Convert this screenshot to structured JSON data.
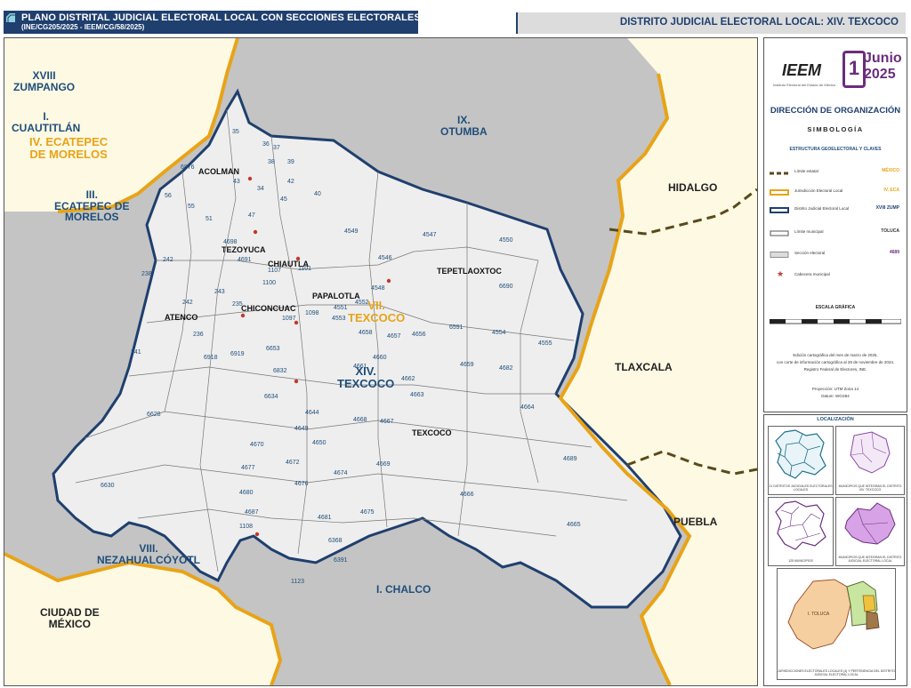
{
  "header": {
    "title": "PLANO DISTRITAL JUDICIAL ELECTORAL LOCAL CON SECCIONES ELECTORALES",
    "subtitle": "(INE/CG205/2025 - IEEM/CG/58/2025)",
    "district": "DISTRITO JUDICIAL ELECTORAL LOCAL: XIV. TEXCOCO"
  },
  "map": {
    "district_labels": [
      {
        "text": "XVIII\nZUMPANGO",
        "style": "blue"
      },
      {
        "text": "I.\nCUAUTITLÁN",
        "style": "blue"
      },
      {
        "text": "IV. ECATEPEC\nDE MORELOS",
        "style": "gold"
      },
      {
        "text": "III.\nECATEPEC DE\nMORELOS",
        "style": "blue"
      },
      {
        "text": "IX.\nOTUMBA",
        "style": "blue"
      },
      {
        "text": "VII.\nTEXCOCO",
        "style": "gold"
      },
      {
        "text": "XIV.\nTEXCOCO",
        "style": "blue"
      },
      {
        "text": "VIII.\nNEZAHUALCÓYOTL",
        "style": "blue"
      },
      {
        "text": "I. CHALCO",
        "style": "blue"
      }
    ],
    "state_labels": [
      "HIDALGO",
      "TLAXCALA",
      "PUEBLA",
      "CIUDAD DE\nMÉXICO"
    ],
    "municipalities": [
      "ACOLMAN",
      "TEZOYUCA",
      "CHIAUTLA",
      "PAPALOTLA",
      "TEPETLAOXTOC",
      "CHICONCUAC",
      "ATENCO",
      "TEXCOCO"
    ],
    "sections": [
      "35",
      "36",
      "37",
      "38",
      "39",
      "6876",
      "43",
      "34",
      "42",
      "40",
      "56",
      "55",
      "51",
      "47",
      "45",
      "4698",
      "4691",
      "1107",
      "1101",
      "4549",
      "4547",
      "4550",
      "4546",
      "6690",
      "238",
      "242",
      "243",
      "241",
      "242",
      "235",
      "236",
      "6918",
      "6919",
      "1100",
      "1097",
      "1098",
      "4551",
      "4553",
      "4548",
      "4552",
      "4658",
      "4657",
      "4656",
      "6591",
      "4554",
      "4555",
      "4663",
      "4660",
      "4662",
      "4659",
      "4682",
      "6832",
      "4661",
      "6653",
      "6628",
      "4664",
      "4644",
      "4668",
      "4667",
      "6634",
      "4670",
      "4649",
      "4650",
      "4669",
      "4689",
      "6630",
      "4677",
      "4672",
      "4676",
      "4674",
      "4680",
      "4675",
      "4666",
      "4665",
      "4687",
      "4681",
      "6368",
      "6391",
      "1108",
      "1123"
    ]
  },
  "legend": {
    "org_logo_text": "IEEM",
    "org_subtitle": "Instituto Electoral del Estado de México",
    "event_badge": "1",
    "event_month": "Junio",
    "event_year": "2025",
    "direction": "DIRECCIÓN DE ORGANIZACIÓN",
    "simbologia": "SIMBOLOGÍA",
    "structure": "ESTRUCTURA GEOELECTORAL Y CLAVES",
    "items": [
      {
        "label": "Límite estatal",
        "value": "MÉXICO",
        "color": "#e8a317"
      },
      {
        "label": "Jurisdicción Electoral Local",
        "value": "IV. ECA",
        "color": "#e8a317"
      },
      {
        "label": "Distrito Judicial Electoral Local",
        "value": "XVIII ZUMP",
        "color": "#1f3f6e"
      },
      {
        "label": "Límite municipal",
        "value": "TOLUCA",
        "color": "#333333"
      },
      {
        "label": "Sección electoral",
        "value": "4689",
        "color": "#6b2d7d"
      },
      {
        "label": "Cabecera municipal",
        "value": "",
        "color": "#c0392b"
      }
    ],
    "scale_title": "ESCALA GRÁFICA",
    "edition": [
      "Edición cartográfica del mes de marzo de 2025,",
      "con corte de información cartográfica al 28 de noviembre de 2024.",
      "Registro Federal de Electores, INE."
    ],
    "projection": [
      "Proyección: UTM Zona 14",
      "Datum: WGS84"
    ]
  },
  "localization": {
    "title": "LOCALIZACIÓN",
    "captions": [
      "21 DISTRITOS JUDICIALES ELECTORALES LOCALES",
      "MUNICIPIOS QUE INTEGRAN EL DISTRITO XIV. TEXCOCO",
      "125 MUNICIPIOS",
      "MUNICIPIOS QUE INTEGRAN EL DISTRITO JUDICIAL ELECTORAL LOCAL",
      "JURISDICCIONES ELECTORALES LOCALES (4) Y PERTENENCIA DEL DISTRITO JUDICIAL ELECTORAL LOCAL",
      "I. TOLUCA"
    ]
  },
  "colors": {
    "state_border": "#e8a317",
    "district_border": "#1f3f6e",
    "district_fill": "#eeeeee",
    "outside_fill": "#c4c4c4",
    "neighbor_state_fill": "#fdf9e3",
    "municipal_head": "#c0392b"
  }
}
